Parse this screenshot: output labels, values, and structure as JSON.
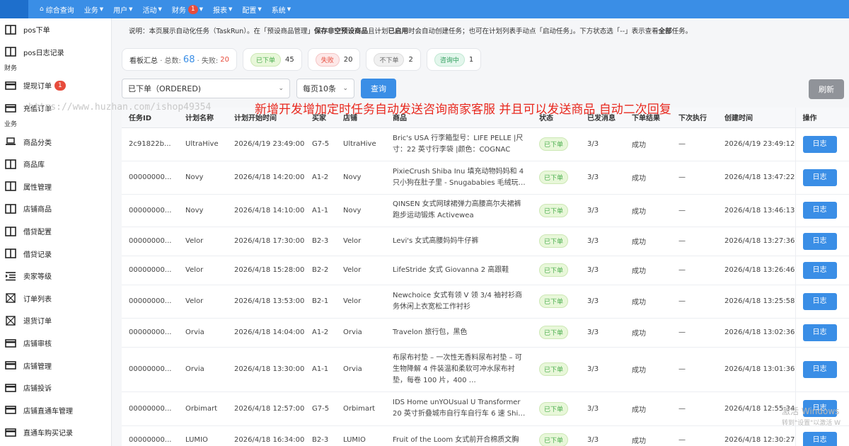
{
  "topnav": [
    {
      "label": "综合查询",
      "icon": "home-icon",
      "has_caret": false,
      "badge": ""
    },
    {
      "label": "业务",
      "has_caret": true,
      "badge": ""
    },
    {
      "label": "用户",
      "has_caret": true,
      "badge": ""
    },
    {
      "label": "活动",
      "has_caret": true,
      "badge": ""
    },
    {
      "label": "财务",
      "has_caret": true,
      "badge": "1"
    },
    {
      "label": "报表",
      "has_caret": true,
      "badge": ""
    },
    {
      "label": "配置",
      "has_caret": true,
      "badge": ""
    },
    {
      "label": "系统",
      "has_caret": true,
      "badge": ""
    }
  ],
  "sidebar": {
    "items": [
      {
        "type": "item",
        "label": "pos下单",
        "icon": "window-icon"
      },
      {
        "type": "item",
        "label": "pos日志记录",
        "icon": "window-icon"
      },
      {
        "type": "group",
        "label": "财务"
      },
      {
        "type": "item",
        "label": "提现订单",
        "icon": "card-icon",
        "badge": "1"
      },
      {
        "type": "item",
        "label": "充值订单",
        "icon": "card-icon"
      },
      {
        "type": "group",
        "label": "业务"
      },
      {
        "type": "item",
        "label": "商品分类",
        "icon": "laptop-icon"
      },
      {
        "type": "item",
        "label": "商品库",
        "icon": "window-icon"
      },
      {
        "type": "item",
        "label": "属性管理",
        "icon": "window-icon"
      },
      {
        "type": "item",
        "label": "店铺商品",
        "icon": "window-icon"
      },
      {
        "type": "item",
        "label": "借贷配置",
        "icon": "window-icon"
      },
      {
        "type": "item",
        "label": "借贷记录",
        "icon": "window-icon"
      },
      {
        "type": "item",
        "label": "卖家等级",
        "icon": "list-indent-icon"
      },
      {
        "type": "item",
        "label": "订单列表",
        "icon": "hourglass-icon"
      },
      {
        "type": "item",
        "label": "退货订单",
        "icon": "hourglass-icon"
      },
      {
        "type": "item",
        "label": "店铺审核",
        "icon": "card-icon"
      },
      {
        "type": "item",
        "label": "店铺管理",
        "icon": "card-icon"
      },
      {
        "type": "item",
        "label": "店铺投诉",
        "icon": "card-icon"
      },
      {
        "type": "item",
        "label": "店铺直通车管理",
        "icon": "card-icon"
      },
      {
        "type": "item",
        "label": "直通车购买记录",
        "icon": "card-icon"
      }
    ]
  },
  "notice": {
    "prefix": "说明：本页展示自动化任务（TaskRun）。在「预设商品管理」",
    "bold1": "保存非空预设商品",
    "mid1": "且计划",
    "bold2": "已启用",
    "mid2": "时会自动创建任务；也可在计划列表手动点「启动任务」。下方状态选「--」表示查看",
    "bold3": "全部",
    "suffix": "任务。"
  },
  "stats": {
    "summary_label": "看板汇总",
    "total_label": "· 总数:",
    "total": "68",
    "fail_label": "· 失败:",
    "fail": "20",
    "pills": [
      {
        "label": "已下单",
        "count": "45",
        "color": "green"
      },
      {
        "label": "失败",
        "count": "20",
        "color": "red"
      },
      {
        "label": "不下单",
        "count": "2",
        "color": "gray"
      },
      {
        "label": "咨询中",
        "count": "1",
        "color": "cyan"
      }
    ]
  },
  "filters": {
    "status_value": "已下单（ORDERED)",
    "page_size_value": "每页10条",
    "query_label": "查询",
    "refresh_label": "刷新"
  },
  "overlay_text": "新增开发增加定时任务自动发送咨询商家客服 并且可以发送商品 自动二次回复",
  "watermark_url": "https://www.huzhan.com/ishop49354",
  "windows_watermark": {
    "line1": "激活 Windows",
    "line2": "转到\"设置\"以激活 W"
  },
  "table": {
    "headers": [
      "任务ID",
      "计划名称",
      "计划开始时间",
      "买家",
      "店铺",
      "商品",
      "状态",
      "已发消息",
      "下单结果",
      "下次执行",
      "创建时间",
      "操作"
    ],
    "rows": [
      {
        "id": "2c91822b...",
        "plan": "UltraHive",
        "start": "2026/4/19 23:49:00",
        "buyer": "G7-5",
        "shop": "UltraHive",
        "product": "Bric's USA 行李箱型号：LIFE PELLE |尺寸：22 英寸行李袋 |颜色：COGNAC",
        "status": "已下单",
        "sent": "3/3",
        "result": "成功",
        "next": "—",
        "created": "2026/4/19 23:49:12",
        "action": "日志"
      },
      {
        "id": "00000000...",
        "plan": "Novy",
        "start": "2026/4/18 14:20:00",
        "buyer": "A1-2",
        "shop": "Novy",
        "product": "PixieCrush Shiba Inu 填充动物妈妈和 4 只小狗在肚子里 - Snugababies 毛绒玩…",
        "status": "已下单",
        "sent": "3/3",
        "result": "成功",
        "next": "—",
        "created": "2026/4/18 13:47:22",
        "action": "日志"
      },
      {
        "id": "00000000...",
        "plan": "Novy",
        "start": "2026/4/18 14:10:00",
        "buyer": "A1-1",
        "shop": "Novy",
        "product": "QINSEN 女式网球裙弹力高腰高尔夫裙裤跑步运动锻炼 Activewea",
        "status": "已下单",
        "sent": "3/3",
        "result": "成功",
        "next": "—",
        "created": "2026/4/18 13:46:13",
        "action": "日志"
      },
      {
        "id": "00000000...",
        "plan": "Velor",
        "start": "2026/4/18 17:30:00",
        "buyer": "B2-3",
        "shop": "Velor",
        "product": "Levi's 女式高腰妈妈牛仔裤",
        "status": "已下单",
        "sent": "3/3",
        "result": "成功",
        "next": "—",
        "created": "2026/4/18 13:27:36",
        "action": "日志"
      },
      {
        "id": "00000000...",
        "plan": "Velor",
        "start": "2026/4/18 15:28:00",
        "buyer": "B2-2",
        "shop": "Velor",
        "product": "LifeStride 女式 Giovanna 2 高跟鞋",
        "status": "已下单",
        "sent": "3/3",
        "result": "成功",
        "next": "—",
        "created": "2026/4/18 13:26:46",
        "action": "日志"
      },
      {
        "id": "00000000...",
        "plan": "Velor",
        "start": "2026/4/18 13:53:00",
        "buyer": "B2-1",
        "shop": "Velor",
        "product": "Newchoice 女式有领 V 领 3/4 袖衬衫商务休闲上衣宽松工作衬衫",
        "status": "已下单",
        "sent": "3/3",
        "result": "成功",
        "next": "—",
        "created": "2026/4/18 13:25:58",
        "action": "日志"
      },
      {
        "id": "00000000...",
        "plan": "Orvia",
        "start": "2026/4/18 14:04:00",
        "buyer": "A1-2",
        "shop": "Orvia",
        "product": "Travelon 旅行包，黑色",
        "status": "已下单",
        "sent": "3/3",
        "result": "成功",
        "next": "—",
        "created": "2026/4/18 13:02:36",
        "action": "日志"
      },
      {
        "id": "00000000...",
        "plan": "Orvia",
        "start": "2026/4/18 13:30:00",
        "buyer": "A1-1",
        "shop": "Orvia",
        "product": "布尿布衬垫 – 一次性无香料尿布衬垫 – 可生物降解 4 件装温和柔软可冲水尿布衬垫，每卷 100 片，400 …",
        "status": "已下单",
        "sent": "3/3",
        "result": "成功",
        "next": "—",
        "created": "2026/4/18 13:01:36",
        "action": "日志"
      },
      {
        "id": "00000000...",
        "plan": "Orbimart",
        "start": "2026/4/18 12:57:00",
        "buyer": "G7-5",
        "shop": "Orbimart",
        "product": "IDS Home unYOUsual U Transformer 20 英寸折叠城市自行车自行车 6 速 Shi…",
        "status": "已下单",
        "sent": "3/3",
        "result": "成功",
        "next": "—",
        "created": "2026/4/18 12:55:34",
        "action": "日志"
      },
      {
        "id": "00000000...",
        "plan": "LUMIO",
        "start": "2026/4/18 16:34:00",
        "buyer": "B2-3",
        "shop": "LUMIO",
        "product": "Fruit of the Loom 女式前开合棉质文胸",
        "status": "已下单",
        "sent": "3/3",
        "result": "成功",
        "next": "—",
        "created": "2026/4/18 12:30:27",
        "action": "日志"
      }
    ]
  }
}
